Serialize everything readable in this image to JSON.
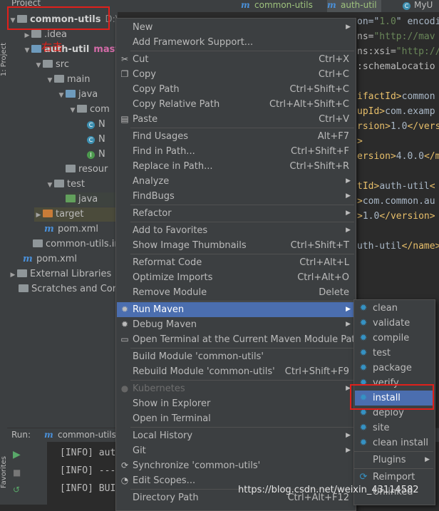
{
  "left_strip": {
    "project_label": "1: Project",
    "favorites_label": "Favorites"
  },
  "project_panel": {
    "header": "Project",
    "tree": [
      {
        "label": "common-utils",
        "extra": "D:\\DEMO\\...",
        "icon": "module-folder-icon"
      },
      {
        "label": ".idea",
        "icon": "folder-icon"
      },
      {
        "label": "auth-util",
        "branch": "maste",
        "icon": "module-folder-icon"
      },
      {
        "label": "src",
        "icon": "folder-icon"
      },
      {
        "label": "main",
        "icon": "folder-icon"
      },
      {
        "label": "java",
        "icon": "source-folder-icon"
      },
      {
        "label": "com",
        "icon": "package-icon"
      },
      {
        "label": "N",
        "icon": "class-icon"
      },
      {
        "label": "N",
        "icon": "class-icon"
      },
      {
        "label": "N",
        "icon": "interface-icon"
      },
      {
        "label": "resour",
        "icon": "resources-folder-icon"
      },
      {
        "label": "test",
        "icon": "folder-icon"
      },
      {
        "label": "java",
        "icon": "test-folder-icon"
      },
      {
        "label": "target",
        "icon": "excluded-folder-icon"
      },
      {
        "label": "pom.xml",
        "icon": "maven-icon"
      },
      {
        "label": "common-utils.im",
        "icon": "iml-icon"
      },
      {
        "label": "pom.xml",
        "icon": "maven-icon"
      },
      {
        "label": "External Libraries",
        "icon": "library-icon"
      },
      {
        "label": "Scratches and Cons",
        "icon": "scratches-icon"
      }
    ],
    "annotation": "右击"
  },
  "tabs": [
    {
      "label": "common-utils"
    },
    {
      "label": "auth-util"
    },
    {
      "label": "MyU"
    }
  ],
  "editor_lines": [
    {
      "parts": [
        [
          "txt",
          "on=\""
        ],
        [
          "str",
          "1.0"
        ],
        [
          "txt",
          "\" encodi"
        ]
      ]
    },
    {
      "parts": [
        [
          "attr",
          "ns="
        ],
        [
          "str",
          "\"http://mav"
        ]
      ]
    },
    {
      "parts": [
        [
          "attr",
          "ns:xsi="
        ],
        [
          "str",
          "\"http://"
        ]
      ]
    },
    {
      "parts": [
        [
          "attr",
          ":schemaLocatio"
        ]
      ]
    },
    {
      "parts": []
    },
    {
      "parts": [
        [
          "tag",
          "ifactId>"
        ],
        [
          "txt",
          "common"
        ]
      ]
    },
    {
      "parts": [
        [
          "tag",
          "upId>"
        ],
        [
          "txt",
          "com.examp"
        ]
      ]
    },
    {
      "parts": [
        [
          "tag",
          "rsion>"
        ],
        [
          "txt",
          "1.0"
        ],
        [
          "tag",
          "</vers"
        ]
      ]
    },
    {
      "parts": [
        [
          "tag",
          ">"
        ]
      ]
    },
    {
      "parts": [
        [
          "tag",
          "ersion>"
        ],
        [
          "txt",
          "4.0.0"
        ],
        [
          "tag",
          "</m"
        ]
      ]
    },
    {
      "parts": []
    },
    {
      "parts": [
        [
          "tag",
          "tId>"
        ],
        [
          "txt",
          "auth-util"
        ],
        [
          "tag",
          "<"
        ]
      ]
    },
    {
      "parts": [
        [
          "tag",
          ">"
        ],
        [
          "txt",
          "com.common.au"
        ]
      ]
    },
    {
      "parts": [
        [
          "tag",
          ">"
        ],
        [
          "txt",
          "1.0"
        ],
        [
          "tag",
          "</version>"
        ]
      ]
    },
    {
      "parts": []
    },
    {
      "parts": [
        [
          "txt",
          "uth-util"
        ],
        [
          "tag",
          "</name>"
        ]
      ]
    }
  ],
  "context_menu": {
    "items": [
      {
        "label": "New",
        "submenu": true
      },
      {
        "label": "Add Framework Support..."
      },
      {
        "sep": true
      },
      {
        "label": "Cut",
        "shortcut": "Ctrl+X",
        "icon": "cut-icon"
      },
      {
        "label": "Copy",
        "shortcut": "Ctrl+C",
        "icon": "copy-icon"
      },
      {
        "label": "Copy Path",
        "shortcut": "Ctrl+Shift+C"
      },
      {
        "label": "Copy Relative Path",
        "shortcut": "Ctrl+Alt+Shift+C"
      },
      {
        "label": "Paste",
        "shortcut": "Ctrl+V",
        "icon": "paste-icon"
      },
      {
        "sep": true
      },
      {
        "label": "Find Usages",
        "shortcut": "Alt+F7"
      },
      {
        "label": "Find in Path...",
        "shortcut": "Ctrl+Shift+F"
      },
      {
        "label": "Replace in Path...",
        "shortcut": "Ctrl+Shift+R"
      },
      {
        "label": "Analyze",
        "submenu": true
      },
      {
        "label": "FindBugs",
        "submenu": true
      },
      {
        "sep": true
      },
      {
        "label": "Refactor",
        "submenu": true
      },
      {
        "sep": true
      },
      {
        "label": "Add to Favorites",
        "submenu": true
      },
      {
        "label": "Show Image Thumbnails",
        "shortcut": "Ctrl+Shift+T"
      },
      {
        "sep": true
      },
      {
        "label": "Reformat Code",
        "shortcut": "Ctrl+Alt+L"
      },
      {
        "label": "Optimize Imports",
        "shortcut": "Ctrl+Alt+O"
      },
      {
        "label": "Remove Module",
        "shortcut": "Delete"
      },
      {
        "sep": true
      },
      {
        "label": "Run Maven",
        "submenu": true,
        "icon": "maven-gear-icon",
        "selected": true
      },
      {
        "label": "Debug Maven",
        "submenu": true,
        "icon": "maven-gear-icon"
      },
      {
        "label": "Open Terminal at the Current Maven Module Path",
        "icon": "terminal-icon"
      },
      {
        "sep": true
      },
      {
        "label": "Build Module 'common-utils'"
      },
      {
        "label": "Rebuild Module 'common-utils'",
        "shortcut": "Ctrl+Shift+F9"
      },
      {
        "sep": true
      },
      {
        "label": "Kubernetes",
        "submenu": true,
        "icon": "kubernetes-icon",
        "disabled": true
      },
      {
        "label": "Show in Explorer"
      },
      {
        "label": "Open in Terminal"
      },
      {
        "sep": true
      },
      {
        "label": "Local History",
        "submenu": true
      },
      {
        "label": "Git",
        "submenu": true
      },
      {
        "label": "Synchronize 'common-utils'",
        "icon": "sync-icon"
      },
      {
        "label": "Edit Scopes...",
        "icon": "scopes-icon"
      },
      {
        "sep": true
      },
      {
        "label": "Directory Path",
        "shortcut": "Ctrl+Alt+F12"
      }
    ]
  },
  "submenu": {
    "items": [
      {
        "label": "clean"
      },
      {
        "label": "validate"
      },
      {
        "label": "compile"
      },
      {
        "label": "test"
      },
      {
        "label": "package"
      },
      {
        "label": "verify"
      },
      {
        "label": "install",
        "selected": true
      },
      {
        "label": "deploy"
      },
      {
        "label": "site"
      },
      {
        "label": "clean install"
      },
      {
        "sep": true
      },
      {
        "label": "Plugins",
        "submenu": true,
        "noicon": true
      },
      {
        "sep": true
      },
      {
        "label": "Reimport",
        "icon": "reimport-icon"
      },
      {
        "label": "Unlinked"
      }
    ]
  },
  "run_panel": {
    "label": "Run:",
    "tab": "common-utils",
    "log": [
      "[INFO] aut",
      "[INFO] ---",
      "[INFO] BUI"
    ]
  },
  "watermark": "https://blog.csdn.net/weixin_43114582",
  "colors": {
    "selection": "#4b6eaf",
    "highlight_box": "#e0201b",
    "background": "#2b2b2b",
    "panel": "#3c3f41"
  }
}
